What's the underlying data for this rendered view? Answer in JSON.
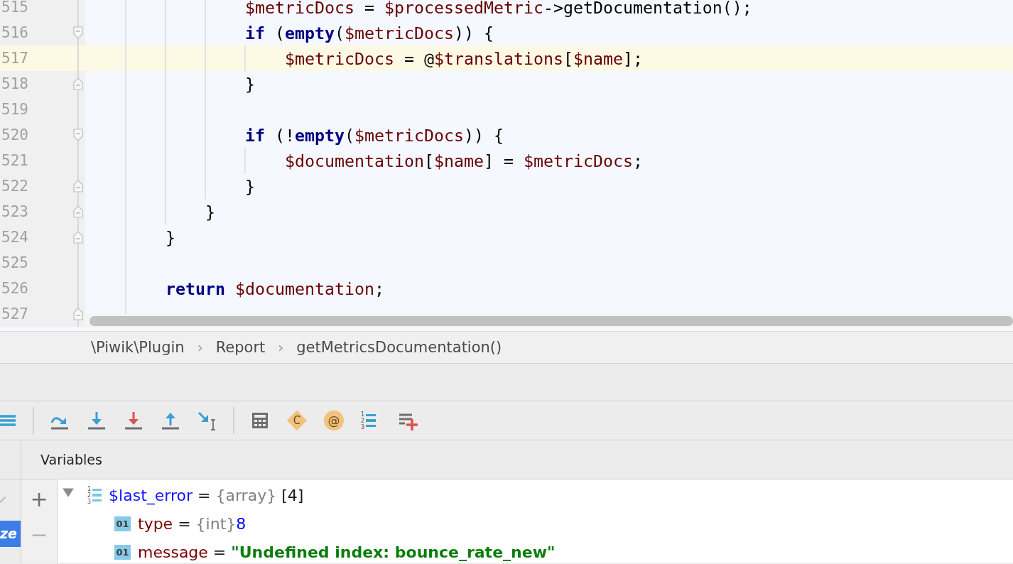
{
  "editor": {
    "lines": [
      {
        "number": "515",
        "current": false,
        "tokens": [
          {
            "t": "                $metricDocs",
            "kind": "var"
          },
          {
            "t": " = ",
            "kind": "plain"
          },
          {
            "t": "$processedMetric",
            "kind": "var"
          },
          {
            "t": "->getDocumentation();",
            "kind": "plain"
          }
        ]
      },
      {
        "number": "516",
        "current": false,
        "fold_start": true,
        "tokens": [
          {
            "t": "                if",
            "kind": "kw"
          },
          {
            "t": " (",
            "kind": "plain"
          },
          {
            "t": "empty",
            "kind": "kw"
          },
          {
            "t": "(",
            "kind": "plain"
          },
          {
            "t": "$metricDocs",
            "kind": "var"
          },
          {
            "t": ")) {",
            "kind": "plain"
          }
        ]
      },
      {
        "number": "517",
        "current": true,
        "tokens": [
          {
            "t": "                    $metricDocs",
            "kind": "var"
          },
          {
            "t": " = @",
            "kind": "plain"
          },
          {
            "t": "$translations",
            "kind": "var"
          },
          {
            "t": "[",
            "kind": "plain"
          },
          {
            "t": "$name",
            "kind": "var"
          },
          {
            "t": "];",
            "kind": "plain"
          }
        ]
      },
      {
        "number": "518",
        "current": false,
        "fold_end": true,
        "tokens": [
          {
            "t": "                }",
            "kind": "plain"
          }
        ]
      },
      {
        "number": "519",
        "current": false
      },
      {
        "number": "520",
        "current": false,
        "fold_start": true,
        "tokens": [
          {
            "t": "                if",
            "kind": "kw"
          },
          {
            "t": " (!",
            "kind": "plain"
          },
          {
            "t": "empty",
            "kind": "kw"
          },
          {
            "t": "(",
            "kind": "plain"
          },
          {
            "t": "$metricDocs",
            "kind": "var"
          },
          {
            "t": ")) {",
            "kind": "plain"
          }
        ]
      },
      {
        "number": "521",
        "current": false,
        "tokens": [
          {
            "t": "                    $documentation",
            "kind": "var"
          },
          {
            "t": "[",
            "kind": "plain"
          },
          {
            "t": "$name",
            "kind": "var"
          },
          {
            "t": "] = ",
            "kind": "plain"
          },
          {
            "t": "$metricDocs",
            "kind": "var"
          },
          {
            "t": ";",
            "kind": "plain"
          }
        ]
      },
      {
        "number": "522",
        "current": false,
        "fold_end": true,
        "tokens": [
          {
            "t": "                }",
            "kind": "plain"
          }
        ]
      },
      {
        "number": "523",
        "current": false,
        "fold_end": true,
        "tokens": [
          {
            "t": "            }",
            "kind": "plain"
          }
        ]
      },
      {
        "number": "524",
        "current": false,
        "fold_end": true,
        "tokens": [
          {
            "t": "        }",
            "kind": "plain"
          }
        ]
      },
      {
        "number": "525",
        "current": false
      },
      {
        "number": "526",
        "current": false,
        "tokens": [
          {
            "t": "        return",
            "kind": "kw"
          },
          {
            "t": " $documentation",
            "kind": "var"
          },
          {
            "t": ";",
            "kind": "plain"
          }
        ]
      },
      {
        "number": "527",
        "current": false,
        "fold_end": true
      }
    ]
  },
  "breadcrumbs": {
    "items": [
      "\\Piwik\\Plugin",
      "Report",
      "getMetricsDocumentation()"
    ],
    "separator": "›"
  },
  "toolbar": [
    {
      "kind": "list"
    },
    {
      "kind": "separator"
    },
    {
      "kind": "step-over"
    },
    {
      "kind": "step-into"
    },
    {
      "kind": "force-step-into"
    },
    {
      "kind": "step-out"
    },
    {
      "kind": "run-to-cursor"
    },
    {
      "kind": "separator"
    },
    {
      "kind": "calculator"
    },
    {
      "kind": "diamond",
      "label": "C"
    },
    {
      "kind": "circle",
      "label": "@"
    },
    {
      "kind": "numbered-list",
      "digits": [
        "1",
        "2",
        "3"
      ]
    },
    {
      "kind": "add-list"
    }
  ],
  "variables": {
    "title": "Variables",
    "side_tab": "ze",
    "add_label": "+",
    "remove_label": "−",
    "assign": "=",
    "items": [
      {
        "name": "$last_error",
        "type": "{array}",
        "value": {
          "text": "[4]",
          "kind": "plain"
        },
        "kind": "array",
        "digits": [
          "1",
          "2",
          "3"
        ],
        "expanded": true,
        "children": [
          {
            "name": "type",
            "type": "{int}",
            "value": {
              "text": "8",
              "kind": "number"
            },
            "kind": "field",
            "badge": "01"
          },
          {
            "name": "message",
            "value": {
              "text": "\"Undefined index: bounce_rate_new\"",
              "kind": "string"
            },
            "kind": "field",
            "badge": "01"
          }
        ]
      }
    ]
  }
}
